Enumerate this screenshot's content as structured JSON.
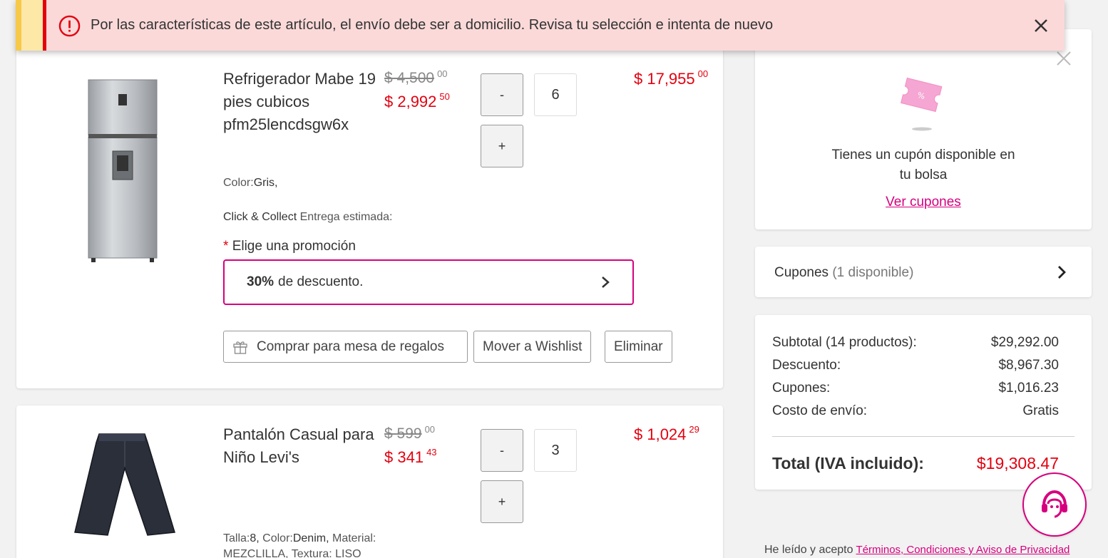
{
  "alert": {
    "message": "Por las características de este artículo, el envío debe ser a domicilio. Revisa tu selección e intenta de nuevo",
    "icon": "error-circle-icon",
    "close_icon": "close-icon"
  },
  "products": [
    {
      "name": "Refrigerador Mabe 19 pies cubicos pfm25lencdsgw6x",
      "price_old": "$ 4,500",
      "price_old_cents": "00",
      "price_new": "$ 2,992",
      "price_new_cents": "50",
      "qty": "6",
      "minus_label": "-",
      "plus_label": "+",
      "total": "$ 17,955",
      "total_cents": "00",
      "attr_color_label": "Color:",
      "attr_color_value": "Gris,",
      "delivery_label": "Click & Collect",
      "delivery_text": "Entrega estimada:",
      "promo_label_star": "*",
      "promo_label": "Elige una promoción",
      "promo_bold": "30%",
      "promo_text": "de descuento.",
      "btn_gift": "Comprar para mesa de regalos",
      "btn_wishlist": "Mover a Wishlist",
      "btn_remove": "Eliminar"
    },
    {
      "name": "Pantalón Casual para Niño Levi's",
      "price_old": "$ 599",
      "price_old_cents": "00",
      "price_new": "$ 341",
      "price_new_cents": "43",
      "qty": "3",
      "minus_label": "-",
      "plus_label": "+",
      "total": "$ 1,024",
      "total_cents": "29",
      "attr_talla_label": "Talla:",
      "attr_talla_value": "8,",
      "attr_color_label": "Color:",
      "attr_color_value": "Denim,",
      "attr_material_label": "Material:",
      "attr_line2": "MEZCLILLA, Textura: LISO"
    }
  ],
  "coupon_card": {
    "text_line1": "Tienes un cupón disponible en",
    "text_line2": "tu bolsa",
    "link": "Ver cupones"
  },
  "cupones": {
    "label": "Cupones",
    "count": "(1 disponible)"
  },
  "summary": {
    "rows": [
      {
        "label": "Subtotal (14 productos):",
        "value": "$29,292.00"
      },
      {
        "label": "Descuento:",
        "value": "$8,967.30"
      },
      {
        "label": "Cupones:",
        "value": "$1,016.23"
      },
      {
        "label": "Costo de envío:",
        "value": "Gratis"
      }
    ],
    "total_label": "Total (IVA incluido):",
    "total_value": "$19,308.47"
  },
  "terms": {
    "text": "He leído y acepto",
    "link": "Términos, Condiciones y Aviso de Privacidad"
  },
  "colors": {
    "accent": "#d6007e",
    "price_red": "#e3000f",
    "alert_bg": "#fbd9d9"
  }
}
